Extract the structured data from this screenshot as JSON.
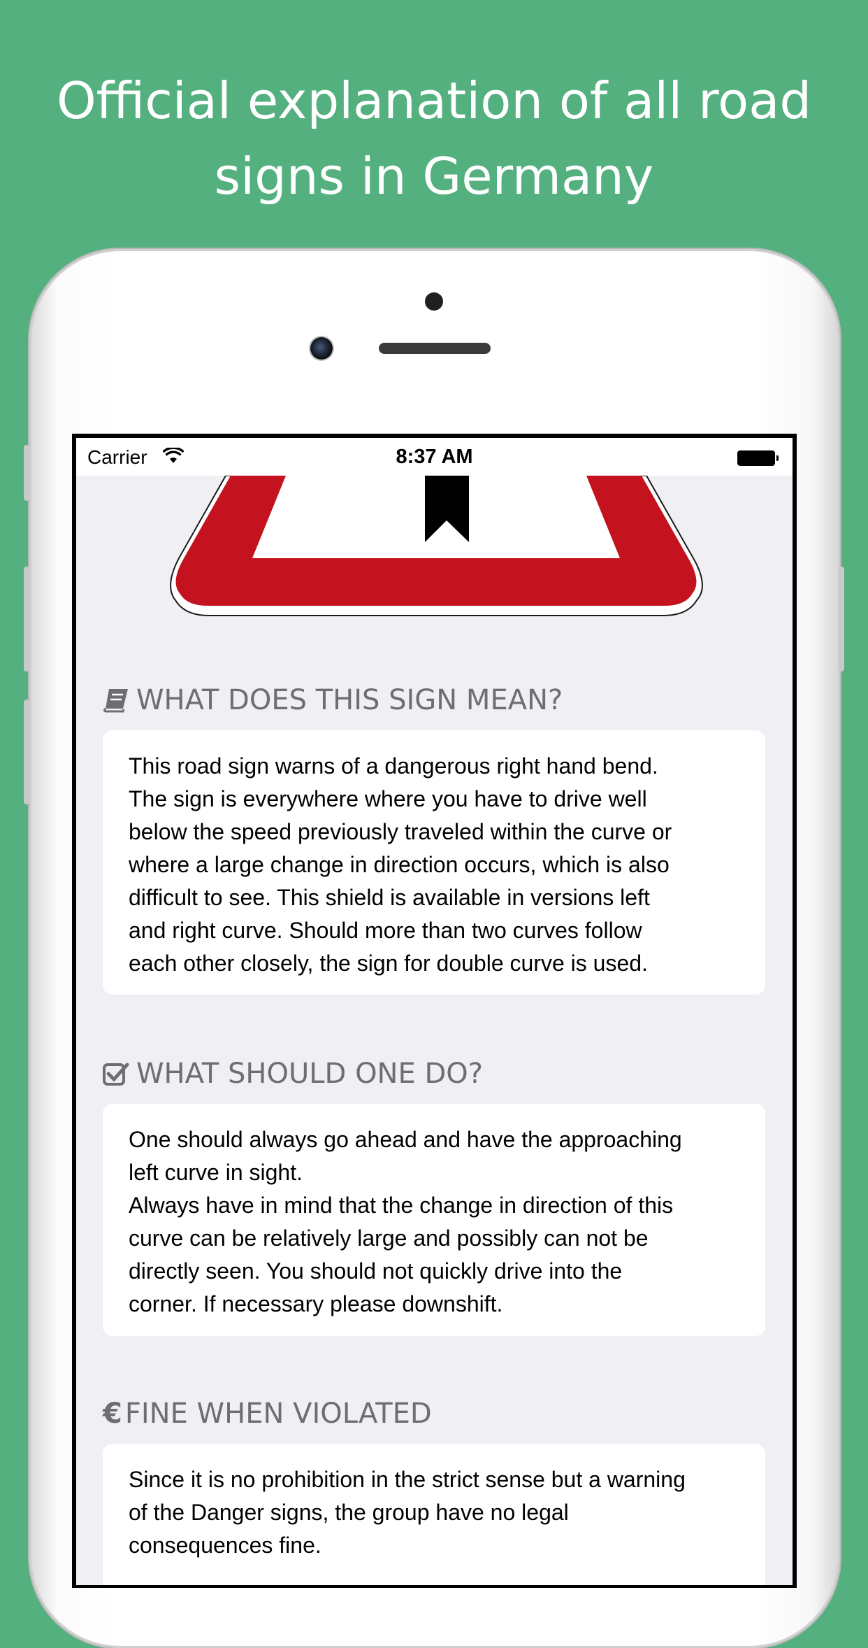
{
  "headline": {
    "line1": "Official explanation of all road",
    "line2": "signs in Germany"
  },
  "status_bar": {
    "carrier": "Carrier",
    "time": "8:37 AM"
  },
  "sections": [
    {
      "title": "WHAT DOES THIS SIGN MEAN?",
      "icon": "book-icon",
      "text": "This road sign warns of a dangerous right hand bend.\nThe sign is everywhere where you have to drive well\nbelow the speed previously traveled within the curve or\nwhere a large change in direction occurs, which is also\ndifficult to see. This shield is available in versions left\nand right curve. Should more than two curves follow\neach other closely, the sign for double curve is used."
    },
    {
      "title": "WHAT SHOULD ONE DO?",
      "icon": "check-square-icon",
      "text": "One should always go ahead and have the approaching\nleft curve in sight.\nAlways have in mind that the change in direction of this\ncurve can be relatively large and possibly can not be\ndirectly seen. You should not quickly drive into the\ncorner. If necessary please downshift."
    },
    {
      "title": "FINE WHEN VIOLATED",
      "icon": "euro-icon",
      "text": "Since it is no prohibition in the strict sense but a warning\nof the Danger signs, the group have no legal\nconsequences fine."
    }
  ],
  "colors": {
    "background": "#55b07f",
    "sign_red": "#c4121e",
    "screen_bg": "#efeff4",
    "section_title": "#6d6d72"
  }
}
